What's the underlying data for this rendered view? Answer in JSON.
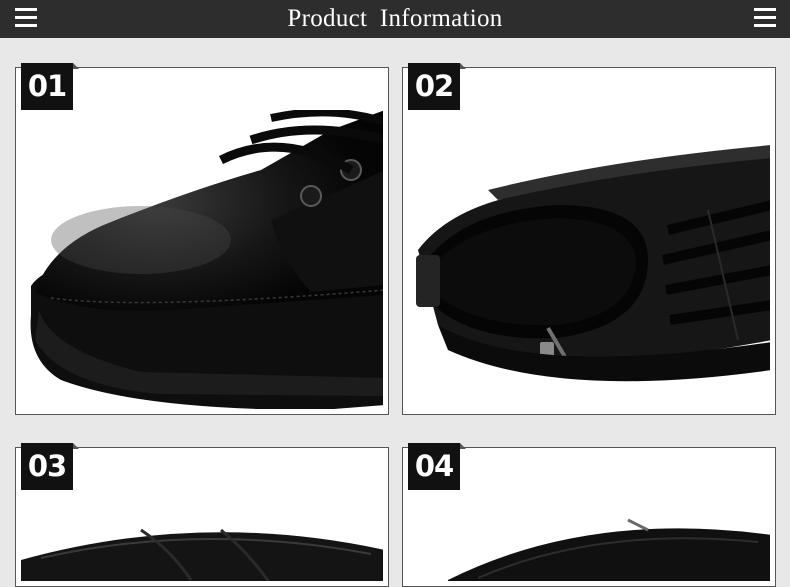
{
  "header": {
    "title": "Product  Information",
    "left_icon": "menu-icon",
    "right_icon": "menu-icon",
    "background": "#2d2d2d"
  },
  "panels": [
    {
      "number": "01",
      "subject": "shoe toe close-up"
    },
    {
      "number": "02",
      "subject": "shoe opening and side zipper"
    },
    {
      "number": "03",
      "subject": "shoe detail"
    },
    {
      "number": "04",
      "subject": "shoe sole detail"
    }
  ],
  "colors": {
    "page_background": "#e8e8e8",
    "badge": "#111111",
    "card_border": "#555555"
  }
}
